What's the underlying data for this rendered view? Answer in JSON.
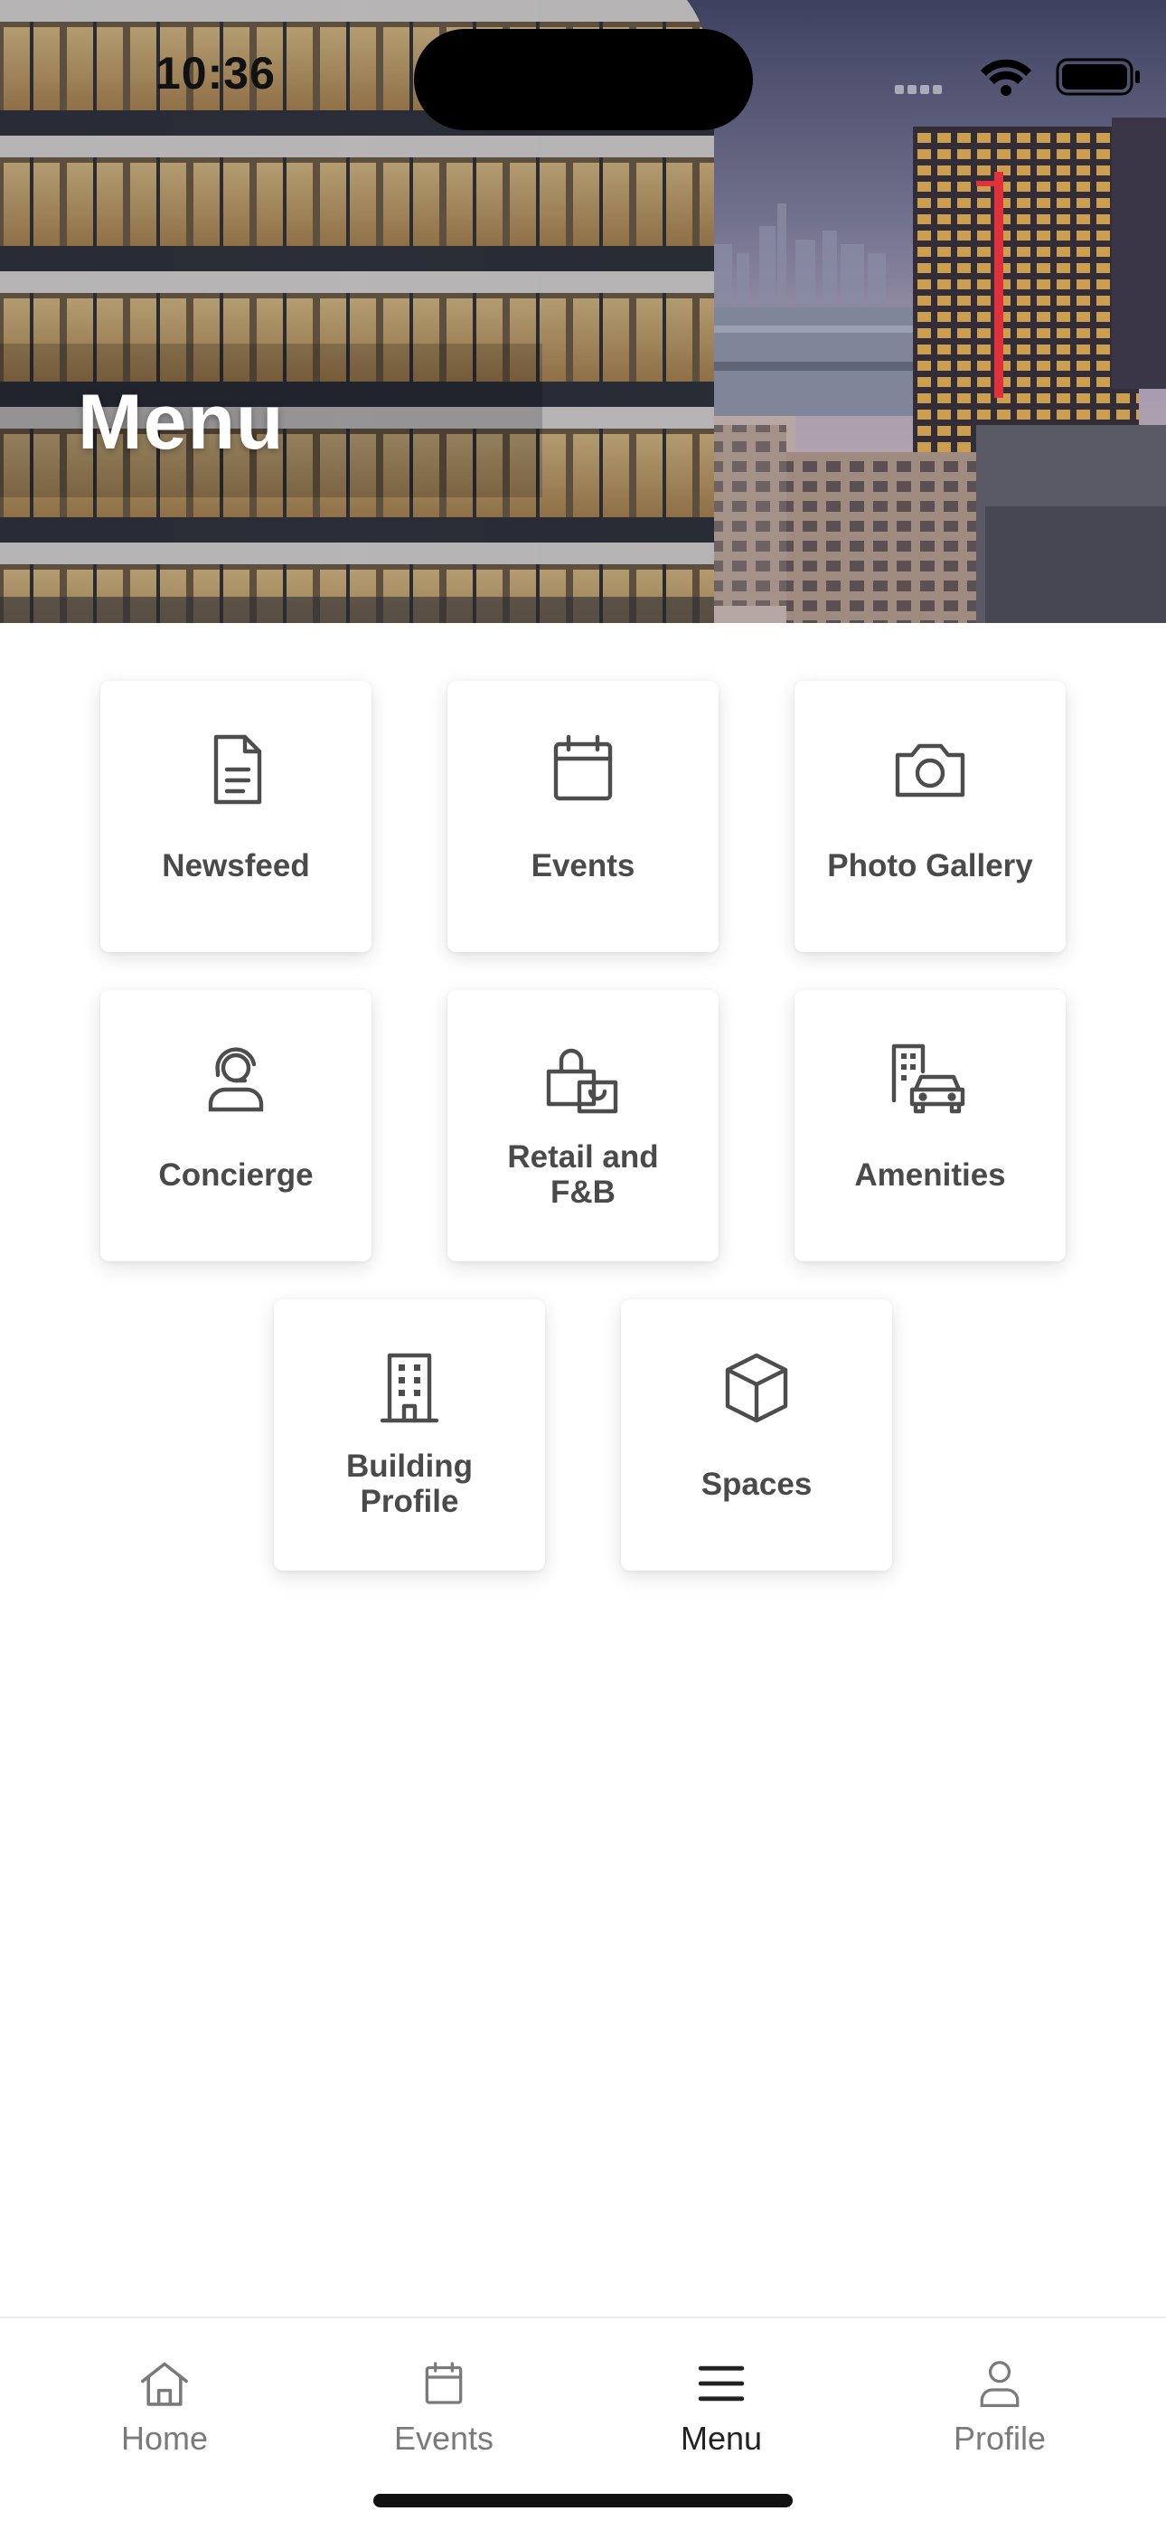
{
  "status_bar": {
    "time": "10:36"
  },
  "header": {
    "title": "Menu"
  },
  "tiles": [
    {
      "label": "Newsfeed",
      "icon": "document-icon"
    },
    {
      "label": "Events",
      "icon": "calendar-icon"
    },
    {
      "label": "Photo Gallery",
      "icon": "camera-icon"
    },
    {
      "label": "Concierge",
      "icon": "headset-person-icon"
    },
    {
      "label": "Retail and\nF&B",
      "icon": "shopping-bag-icon"
    },
    {
      "label": "Amenities",
      "icon": "building-car-icon"
    },
    {
      "label": "Building\nProfile",
      "icon": "office-building-icon"
    },
    {
      "label": "Spaces",
      "icon": "cube-icon"
    }
  ],
  "tab_bar": {
    "items": [
      {
        "label": "Home",
        "icon": "home-icon"
      },
      {
        "label": "Events",
        "icon": "calendar-icon"
      },
      {
        "label": "Menu",
        "icon": "hamburger-menu-icon"
      },
      {
        "label": "Profile",
        "icon": "person-icon"
      }
    ],
    "active": "Menu"
  },
  "colors": {
    "tile_label": "#4a4a4a",
    "icon_stroke": "#4d4d4d",
    "tab_inactive": "#7a7a7a",
    "tab_active": "#222222"
  }
}
